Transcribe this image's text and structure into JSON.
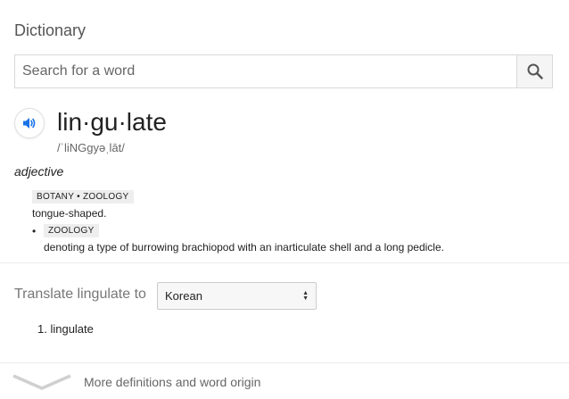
{
  "header": {
    "title": "Dictionary"
  },
  "search": {
    "placeholder": "Search for a word",
    "icon": "search-icon"
  },
  "entry": {
    "word": "lin·gu·late",
    "phonetic": "/ˈliNGgyəˌlāt/",
    "part_of_speech": "adjective",
    "senses": [
      {
        "labels": "BOTANY • ZOOLOGY",
        "definition": "tongue-shaped."
      },
      {
        "labels": "ZOOLOGY",
        "definition": "denoting a type of burrowing brachiopod with an inarticulate shell and a long pedicle."
      }
    ],
    "audio_icon": "speaker-icon"
  },
  "translate": {
    "label": "Translate lingulate to",
    "selected_language": "Korean",
    "results": [
      "1. lingulate"
    ]
  },
  "footer": {
    "more_label": "More definitions and word origin",
    "icon": "chevron-down-icon"
  },
  "colors": {
    "accent": "#1a73e8",
    "border": "#d9d9d9",
    "muted": "#777777"
  }
}
